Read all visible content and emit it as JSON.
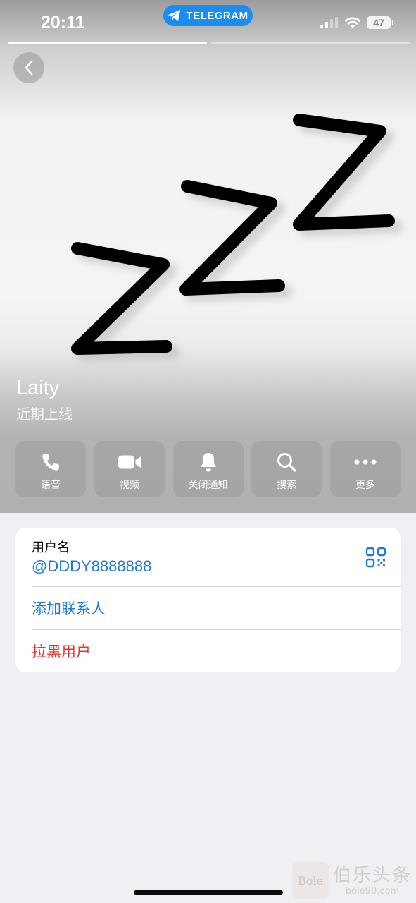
{
  "status_bar": {
    "time": "20:11",
    "app_pill": "TELEGRAM",
    "battery": "47"
  },
  "profile": {
    "name": "Laity",
    "status": "近期上线"
  },
  "actions": [
    {
      "label": "语音",
      "icon": "phone-icon"
    },
    {
      "label": "视频",
      "icon": "video-icon"
    },
    {
      "label": "关闭通知",
      "icon": "bell-icon"
    },
    {
      "label": "搜索",
      "icon": "search-icon"
    },
    {
      "label": "更多",
      "icon": "more-icon"
    }
  ],
  "info": {
    "username_caption": "用户名",
    "username_value": "@DDDY8888888",
    "add_contact": "添加联系人",
    "block_user": "拉黑用户"
  },
  "watermark": {
    "logo": "Bole",
    "text": "伯乐头条",
    "url": "bole90.com"
  },
  "colors": {
    "link_blue": "#1f7ad6",
    "danger_red": "#e8342c",
    "telegram_blue": "#1a8df0"
  }
}
